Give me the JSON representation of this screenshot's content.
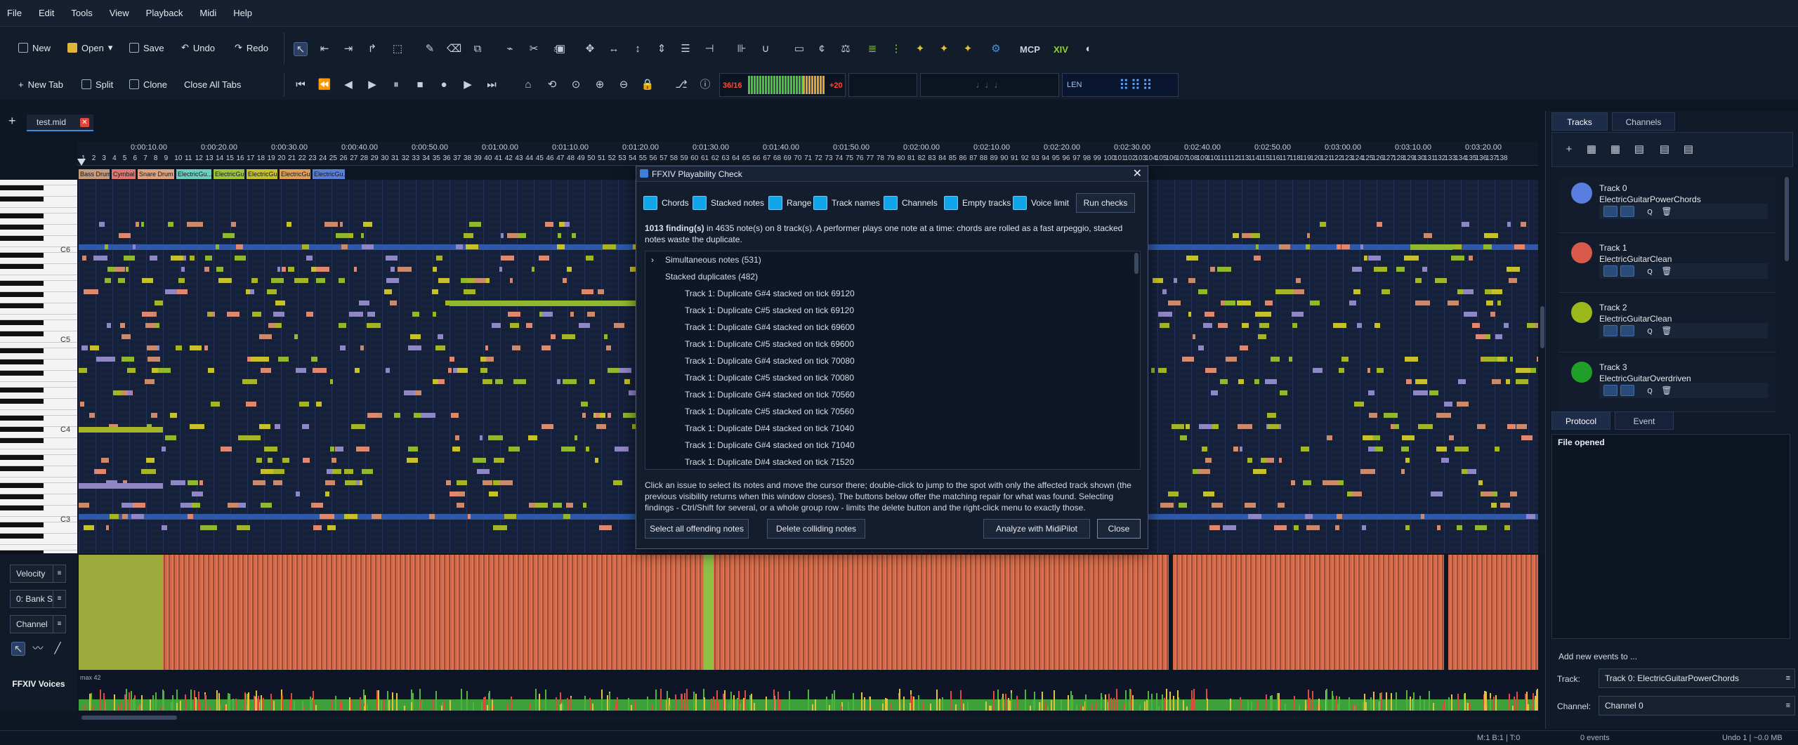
{
  "menu": [
    "File",
    "Edit",
    "Tools",
    "View",
    "Playback",
    "Midi",
    "Help"
  ],
  "toolbar": {
    "new": "New",
    "open": "Open",
    "save": "Save",
    "undo": "Undo",
    "redo": "Redo",
    "new_tab": "New Tab",
    "split": "Split",
    "clone": "Clone",
    "close_all": "Close All Tabs",
    "meter_left": "36/16",
    "meter_right": "+20",
    "len": "LEN",
    "mcp": "MCP",
    "xiv": "XIV"
  },
  "tab": {
    "name": "test.mid",
    "close": "✕"
  },
  "ruler": {
    "times": [
      "0:00:10.00",
      "0:00:20.00",
      "0:00:30.00",
      "0:00:40.00",
      "0:00:50.00",
      "0:01:00.00",
      "0:01:10.00",
      "0:01:20.00",
      "0:01:30.00",
      "0:01:40.00",
      "0:01:50.00",
      "0:02:00.00",
      "0:02:10.00",
      "0:02:20.00",
      "0:02:30.00",
      "0:02:40.00",
      "0:02:50.00",
      "0:03:00.00",
      "0:03:10.00",
      "0:03:20.00"
    ]
  },
  "track_labels": [
    "Bass Drum",
    "Cymbal",
    "Snare Drum",
    "ElectricGu...",
    "ElectricGu...",
    "ElectricGu...",
    "ElectricGu...",
    "ElectricGu..."
  ],
  "piano": {
    "labels": [
      "C6",
      "C5",
      "C4",
      "C3"
    ]
  },
  "left_controls": {
    "velocity": "Velocity",
    "bank": "0: Bank S",
    "channel": "Channel",
    "ffxiv_voices": "FFXIV Voices",
    "max_label": "max 42"
  },
  "dialog": {
    "title": "FFXIV Playability Check",
    "checks": [
      "Chords",
      "Stacked notes",
      "Range",
      "Track names",
      "Channels",
      "Empty tracks",
      "Voice limit"
    ],
    "run": "Run checks",
    "summary_bold": "1013 finding(s)",
    "summary_rest": " in 4635 note(s) on 8 track(s). A performer plays one note at a time: chords are rolled as a fast arpeggio, stacked notes waste the duplicate.",
    "groups": [
      "Simultaneous notes (531)",
      "Stacked duplicates (482)"
    ],
    "rows": [
      "Track 1: Duplicate G#4 stacked on tick 69120",
      "Track 1: Duplicate C#5 stacked on tick 69120",
      "Track 1: Duplicate G#4 stacked on tick 69600",
      "Track 1: Duplicate C#5 stacked on tick 69600",
      "Track 1: Duplicate G#4 stacked on tick 70080",
      "Track 1: Duplicate C#5 stacked on tick 70080",
      "Track 1: Duplicate G#4 stacked on tick 70560",
      "Track 1: Duplicate C#5 stacked on tick 70560",
      "Track 1: Duplicate D#4 stacked on tick 71040",
      "Track 1: Duplicate G#4 stacked on tick 71040",
      "Track 1: Duplicate D#4 stacked on tick 71520"
    ],
    "help": "Click an issue to select its notes and move the cursor there; double-click to jump to the spot with only the affected track shown (the previous visibility returns when this window closes). The buttons below offer the matching repair for what was found. Selecting findings - Ctrl/Shift for several, or a whole group row - limits the delete button and the right-click menu to exactly those.",
    "select_all": "Select all offending notes",
    "delete": "Delete colliding notes",
    "analyze": "Analyze with MidiPilot",
    "close": "Close"
  },
  "right": {
    "tabs": [
      "Tracks",
      "Channels"
    ],
    "tracks": [
      {
        "id": "Track 0",
        "inst": "ElectricGuitarPowerChords",
        "color": "#5a7de0"
      },
      {
        "id": "Track 1",
        "inst": "ElectricGuitarClean",
        "color": "#d9594a"
      },
      {
        "id": "Track 2",
        "inst": "ElectricGuitarClean",
        "color": "#9ab81a"
      },
      {
        "id": "Track 3",
        "inst": "ElectricGuitarOverdriven",
        "color": "#1f9e2a"
      }
    ],
    "bottom_tabs": [
      "Protocol",
      "Event"
    ],
    "protocol_entry": "File opened",
    "add_events": "Add new events to ...",
    "track_label": "Track:",
    "track_value": "Track 0: ElectricGuitarPowerChords",
    "channel_label": "Channel:",
    "channel_value": "Channel 0"
  },
  "status": {
    "pos": "M:1 B:1 | T:0",
    "events": "0 events",
    "mem": "Undo 1 | ~0.0 MB"
  }
}
